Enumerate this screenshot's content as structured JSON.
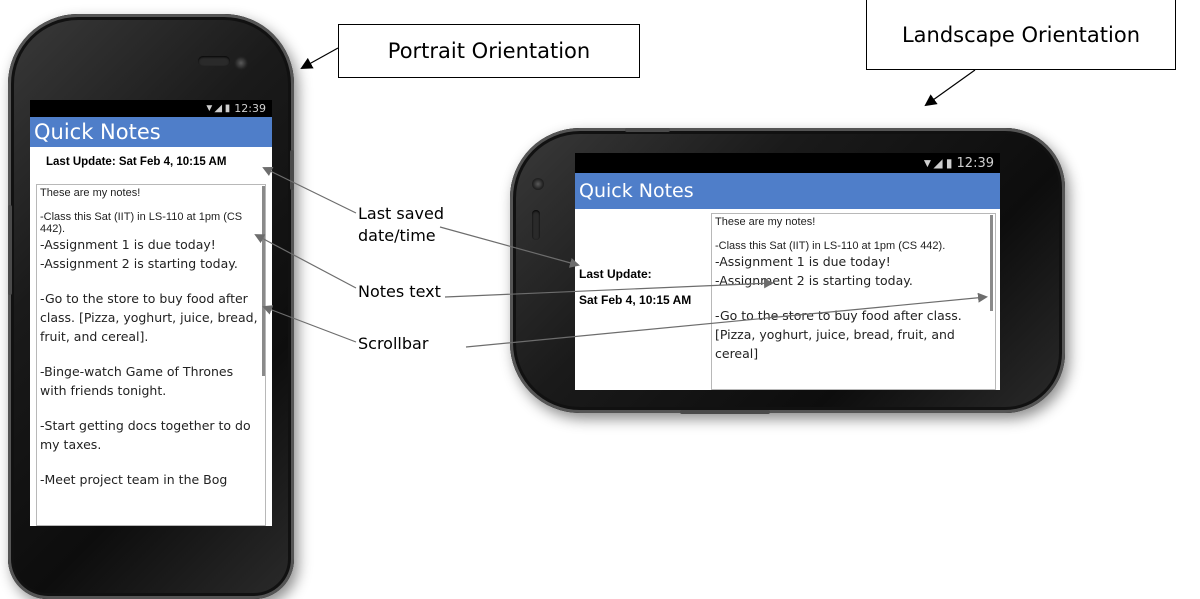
{
  "callouts": {
    "portrait": "Portrait Orientation",
    "landscape": "Landscape Orientation"
  },
  "labels": {
    "last_saved": "Last saved\ndate/time",
    "notes_text": "Notes text",
    "scrollbar": "Scrollbar"
  },
  "status_bar": {
    "icons": "▼◢ ▮",
    "time": "12:39"
  },
  "app": {
    "title": "Quick Notes"
  },
  "portrait": {
    "last_update": "Last Update: Sat Feb 4, 10:15 AM",
    "notes": {
      "l1": "These are my notes!",
      "l2": "-Class this Sat (IIT) in LS-110 at 1pm (CS 442).",
      "l3": "-Assignment 1 is due today!",
      "l4": "-Assignment 2 is starting today.",
      "l5": "-Go to the store to buy food after class. [Pizza, yoghurt, juice, bread, fruit, and cereal].",
      "l6": "-Binge-watch Game of Thrones with friends tonight.",
      "l7": "-Start getting docs together to do my taxes.",
      "l8": "-Meet project team in the Bog"
    }
  },
  "landscape": {
    "last_update_label": "Last Update:",
    "last_update_value": "Sat Feb 4, 10:15 AM",
    "notes": {
      "l1": "These are my notes!",
      "l2": "-Class this Sat (IIT) in LS-110 at 1pm (CS 442).",
      "l3": "-Assignment 1 is due today!",
      "l4": "-Assignment 2 is starting today.",
      "l5": "-Go to the store to buy food after class. [Pizza, yoghurt, juice, bread, fruit, and cereal]"
    }
  }
}
